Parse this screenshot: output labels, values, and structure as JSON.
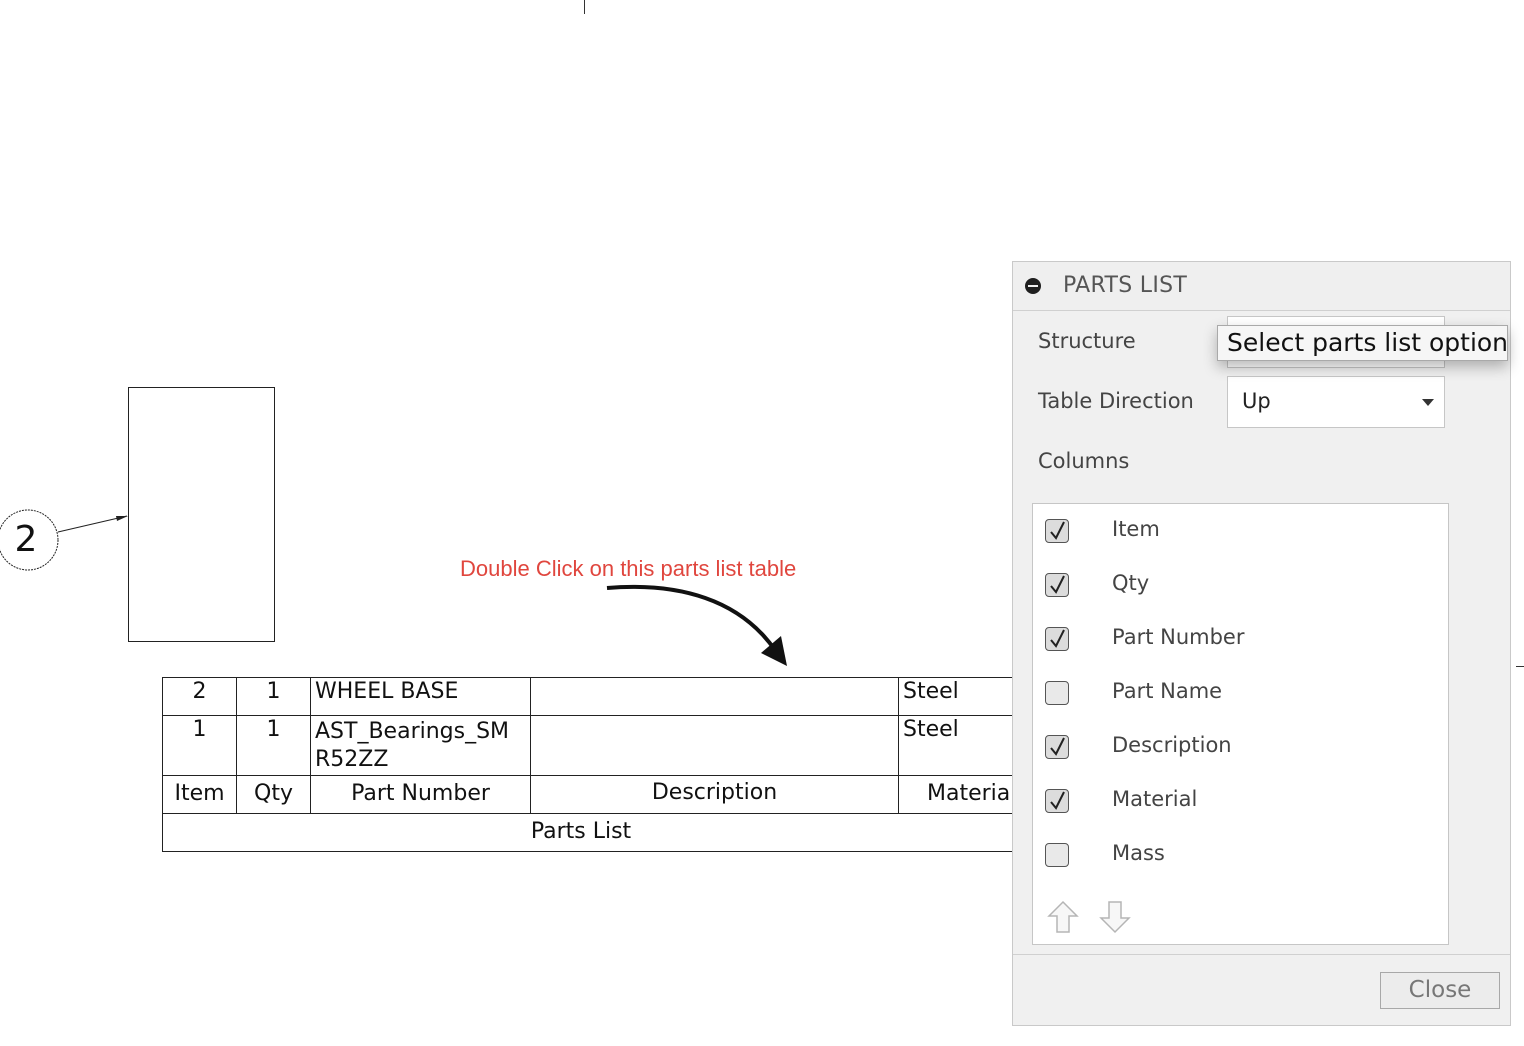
{
  "drawing": {
    "balloon_number": "2",
    "annotation": "Double Click on this parts list table",
    "annotation_color": "#e0463e"
  },
  "parts_list_table": {
    "rows": [
      {
        "item": "2",
        "qty": "1",
        "part_number": "WHEEL BASE",
        "description": "",
        "material": "Steel"
      },
      {
        "item": "1",
        "qty": "1",
        "part_number_line1": "AST_Bearings_SM",
        "part_number_line2": "R52ZZ",
        "description": "",
        "material": "Steel"
      }
    ],
    "headers": {
      "item": "Item",
      "qty": "Qty",
      "part_number": "Part Number",
      "description": "Description",
      "material": "Material"
    },
    "title": "Parts List"
  },
  "dialog": {
    "title": "PARTS LIST",
    "structure_label": "Structure",
    "structure_tooltip": "Select parts list option",
    "table_direction_label": "Table Direction",
    "table_direction_value": "Up",
    "columns_label": "Columns",
    "columns": [
      {
        "label": "Item",
        "checked": true
      },
      {
        "label": "Qty",
        "checked": true
      },
      {
        "label": "Part Number",
        "checked": true
      },
      {
        "label": "Part Name",
        "checked": false
      },
      {
        "label": "Description",
        "checked": true
      },
      {
        "label": "Material",
        "checked": true
      },
      {
        "label": "Mass",
        "checked": false
      }
    ],
    "close_label": "Close",
    "icons": [
      "collapse-icon",
      "move-up-icon",
      "move-down-icon",
      "chevron-down-icon",
      "checkmark-icon"
    ]
  }
}
